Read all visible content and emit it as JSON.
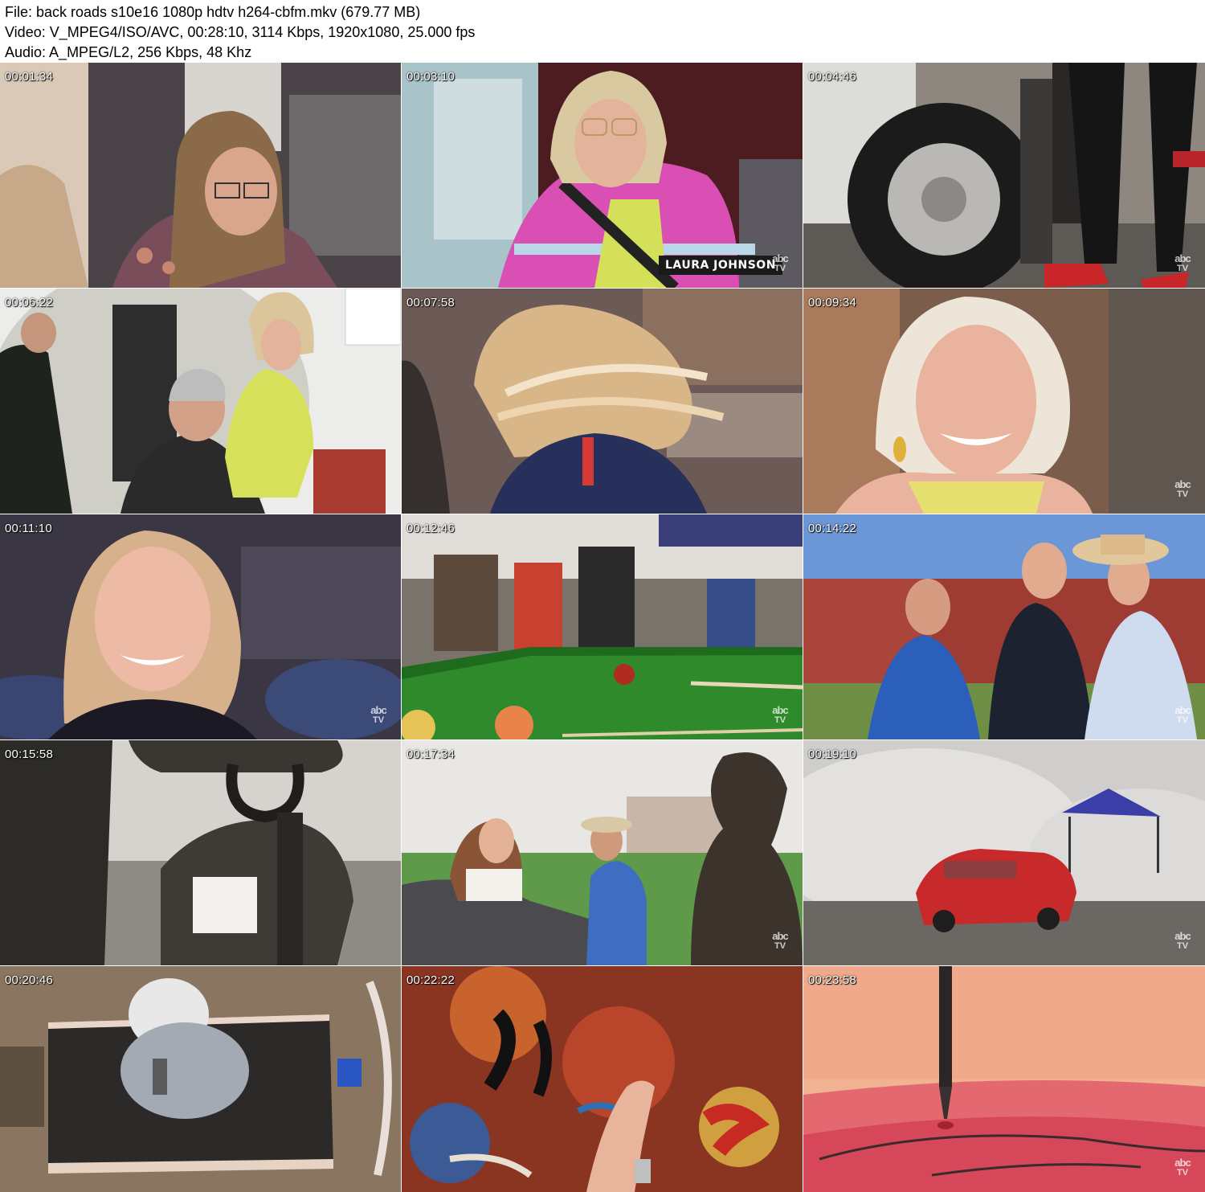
{
  "header": {
    "file_line": "File: back roads s10e16 1080p hdtv h264-cbfm.mkv (679.77 MB)",
    "video_line": "Video: V_MPEG4/ISO/AVC, 00:28:10, 3114 Kbps, 1920x1080, 25.000 fps",
    "audio_line": "Audio: A_MPEG/L2, 256 Kbps, 48 Khz"
  },
  "watermark": {
    "line1": "abc",
    "line2": "TV"
  },
  "thumbnails": [
    {
      "timestamp": "00:01:34"
    },
    {
      "timestamp": "00:03:10",
      "caption": "LAURA JOHNSON"
    },
    {
      "timestamp": "00:04:46"
    },
    {
      "timestamp": "00:06:22"
    },
    {
      "timestamp": "00:07:58"
    },
    {
      "timestamp": "00:09:34"
    },
    {
      "timestamp": "00:11:10"
    },
    {
      "timestamp": "00:12:46"
    },
    {
      "timestamp": "00:14:22"
    },
    {
      "timestamp": "00:15:58"
    },
    {
      "timestamp": "00:17:34"
    },
    {
      "timestamp": "00:19:10"
    },
    {
      "timestamp": "00:20:46"
    },
    {
      "timestamp": "00:22:22"
    },
    {
      "timestamp": "00:23:58"
    }
  ]
}
